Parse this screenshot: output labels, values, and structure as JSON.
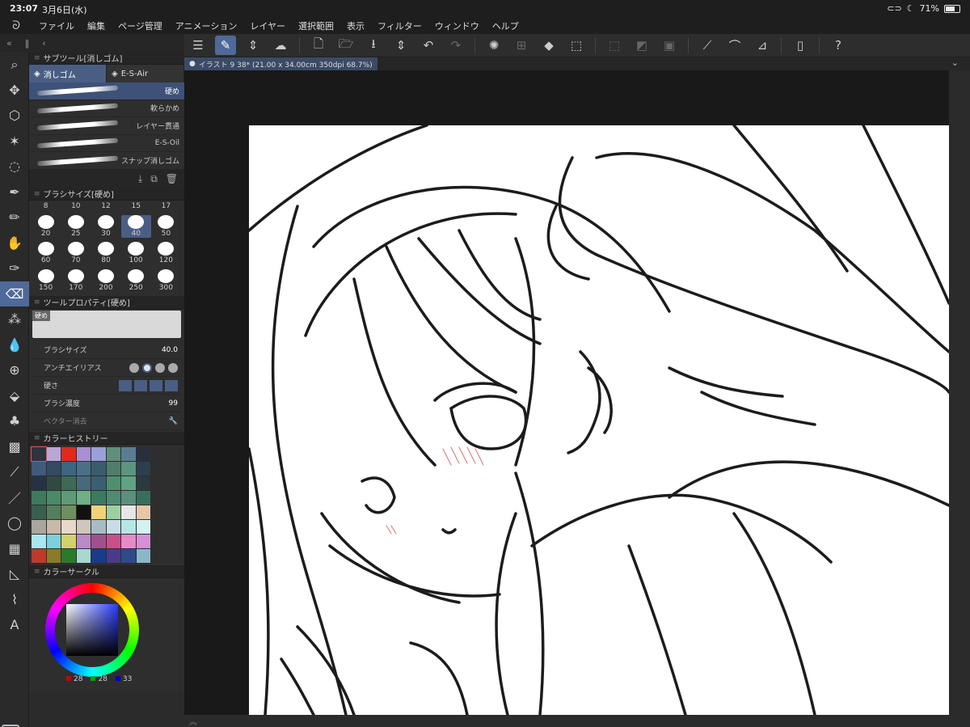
{
  "status": {
    "time": "23:07",
    "date": "3月6日(水)",
    "battery": "71%",
    "battery_level": 0.71
  },
  "menu": [
    "ファイル",
    "編集",
    "ページ管理",
    "アニメーション",
    "レイヤー",
    "選択範囲",
    "表示",
    "フィルター",
    "ウィンドウ",
    "ヘルプ"
  ],
  "subtool": {
    "title": "サブツール[消しゴム]",
    "tabs": [
      "消しゴム",
      "E-S-Air"
    ],
    "brushes": [
      "硬め",
      "軟らかめ",
      "レイヤー貫通",
      "E-S-Oil",
      "スナップ消しゴム"
    ]
  },
  "brushsize": {
    "title": "ブラシサイズ[硬め]",
    "top_row": [
      "8",
      "10",
      "12",
      "15",
      "17"
    ],
    "sizes": [
      "20",
      "25",
      "30",
      "40",
      "50",
      "60",
      "70",
      "80",
      "100",
      "120",
      "150",
      "170",
      "200",
      "250",
      "300"
    ],
    "selected": "40"
  },
  "toolprop": {
    "title": "ツールプロパティ[硬め]",
    "preview_label": "硬め",
    "brush_size_label": "ブラシサイズ",
    "brush_size_value": "40.0",
    "antialias_label": "アンチエイリアス",
    "hardness_label": "硬さ",
    "density_label": "ブラシ濃度",
    "density_value": "99",
    "vector_label": "ベクター消去"
  },
  "colorhistory": {
    "title": "カラーヒストリー",
    "colors": [
      "#2e3440",
      "#b9a6d8",
      "#e02a1f",
      "#a88fd1",
      "#9aa0d8",
      "#5f8f7a",
      "#5b7d94",
      "#2a2f3d",
      "#3f5a7a",
      "#344b63",
      "#3d6680",
      "#4a7088",
      "#3a5d6e",
      "#4f7d6a",
      "#5b9580",
      "#2c3f4e",
      "#243244",
      "#2f4a40",
      "#3c6a55",
      "#476a7a",
      "#3b5f72",
      "#4e8f70",
      "#60a382",
      "#2a3a3e",
      "#3f7a5e",
      "#4b8a66",
      "#5e9a76",
      "#6fae86",
      "#3d7a62",
      "#508a72",
      "#5c8f7e",
      "#3b6d5b",
      "#3a5e50",
      "#557e5c",
      "#6e8f5e",
      "#111111",
      "#f0d27a",
      "#9bd0a0",
      "#e6e6e6",
      "#e8c7a8",
      "#a9a6a0",
      "#c9b9a8",
      "#e8d8cc",
      "#cfc7bd",
      "#a7bdc6",
      "#c8dde6",
      "#b8e6e6",
      "#d6f2f0",
      "#a8e6f0",
      "#7bd0dc",
      "#d2d26a",
      "#b88ac8",
      "#a0508c",
      "#c8508a",
      "#e68ac8",
      "#d690d6",
      "#c0392b",
      "#8a7a2a",
      "#2a7a2a",
      "#a8d8d0",
      "#1a3a8a",
      "#4a3a8a",
      "#2f4a8a",
      "#8ab8c8"
    ]
  },
  "colorcircle": {
    "title": "カラーサークル",
    "r": "28",
    "g": "28",
    "b": "33"
  },
  "document": {
    "tab": "イラスト 9 38* (21.00 x 34.00cm 350dpi 68.7%)"
  }
}
